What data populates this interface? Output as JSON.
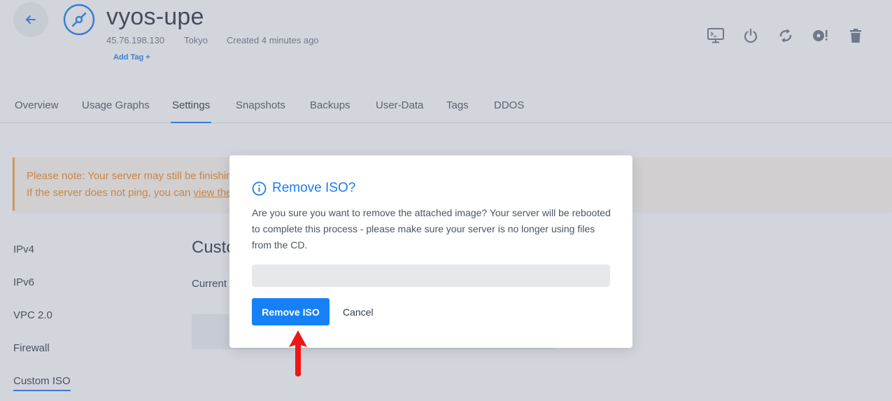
{
  "header": {
    "server_name": "vyos-upe",
    "ip": "45.76.198.130",
    "location": "Tokyo",
    "created": "Created 4 minutes ago",
    "add_tag": "Add Tag +",
    "actions": [
      "console-icon",
      "power-icon",
      "restart-icon",
      "iso-icon",
      "trash-icon"
    ]
  },
  "tabs": [
    {
      "label": "Overview"
    },
    {
      "label": "Usage Graphs"
    },
    {
      "label": "Settings",
      "active": true
    },
    {
      "label": "Snapshots"
    },
    {
      "label": "Backups"
    },
    {
      "label": "User-Data"
    },
    {
      "label": "Tags"
    },
    {
      "label": "DDOS"
    }
  ],
  "notice": {
    "line1": "Please note: Your server may still be finishin",
    "line2_prefix": "If the server does not ping, you can ",
    "line2_link": "view the"
  },
  "sidenav": [
    {
      "label": "IPv4"
    },
    {
      "label": "IPv6"
    },
    {
      "label": "VPC 2.0"
    },
    {
      "label": "Firewall"
    },
    {
      "label": "Custom ISO",
      "active": true
    }
  ],
  "content": {
    "title": "Custo",
    "current": "Current I"
  },
  "modal": {
    "title": "Remove ISO?",
    "body": "Are you sure you want to remove the attached image? Your server will be rebooted to complete this process - please make sure your server is no longer using files from the CD.",
    "field_value": "",
    "confirm_label": "Remove ISO",
    "cancel_label": "Cancel"
  },
  "colors": {
    "accent": "#1d7cf2",
    "warning": "#f08a24",
    "annotation_arrow": "#f01616"
  }
}
